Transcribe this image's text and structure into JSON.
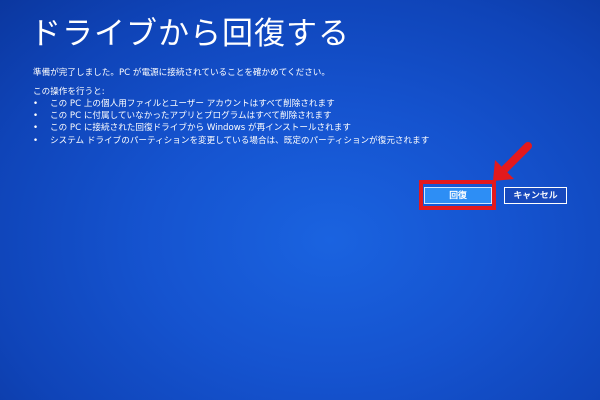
{
  "screen": {
    "title": "ドライブから回復する",
    "message": "準備が完了しました。PC が電源に接続されていることを確かめてください。",
    "subheading": "この操作を行うと:",
    "bullets": [
      "この PC 上の個人用ファイルとユーザー アカウントはすべて削除されます",
      "この PC に付属していなかったアプリとプログラムはすべて削除されます",
      "この PC に接続された回復ドライブから Windows が再インストールされます",
      "システム ドライブのパーティションを変更している場合は、既定のパーティションが復元されます"
    ],
    "bullet_symbol": "•"
  },
  "buttons": {
    "recover_label": "回復",
    "cancel_label": "キャンセル"
  },
  "annotation": {
    "highlight_color": "#e3191d",
    "icon": "red-arrow-icon"
  },
  "colors": {
    "background": "#1553cf",
    "recover_button": "#2d8ef5",
    "text": "#ffffff"
  }
}
